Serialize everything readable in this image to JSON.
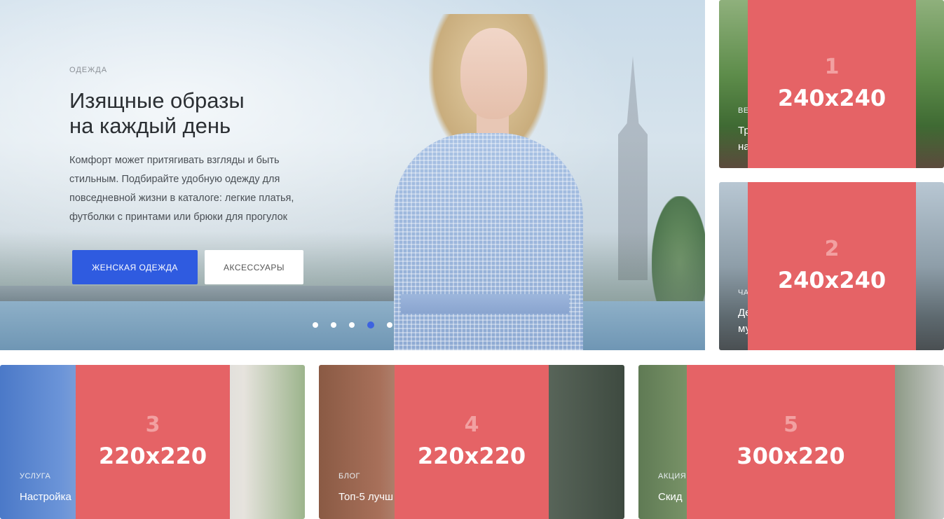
{
  "hero": {
    "category": "ОДЕЖДА",
    "title_line1": "Изящные образы",
    "title_line2": "на каждый день",
    "desc_line1": "Комфорт может притягивать взгляды и быть",
    "desc_line2": "стильным. Подбирайте удобную одежду для",
    "desc_line3": "повседневной жизни в каталоге: легкие платья,",
    "desc_line4": "футболки с принтами или брюки для прогулок",
    "primary_button": "ЖЕНСКАЯ ОДЕЖДА",
    "secondary_button": "АКСЕССУАРЫ",
    "slides_total": 5,
    "active_slide": 4,
    "accent_color": "#2f5be0"
  },
  "cards": [
    {
      "category": "ВЕ",
      "title_line1": "Тр",
      "title_line2": "на",
      "placeholder_num": "1",
      "placeholder_size": "240x240"
    },
    {
      "category": "ЧА",
      "title_line1": "Де",
      "title_line2": "му",
      "placeholder_num": "2",
      "placeholder_size": "240x240"
    },
    {
      "category": "УСЛУГА",
      "title": "Настройка",
      "placeholder_num": "3",
      "placeholder_size": "220x220"
    },
    {
      "category": "БЛОГ",
      "title": "Топ-5 лучш",
      "placeholder_num": "4",
      "placeholder_size": "220x220"
    },
    {
      "category": "АКЦИЯ",
      "title": "Скид",
      "placeholder_num": "5",
      "placeholder_size": "300x220"
    }
  ],
  "colors": {
    "placeholder": "#e56366",
    "placeholder_num": "#f2a0a1"
  }
}
